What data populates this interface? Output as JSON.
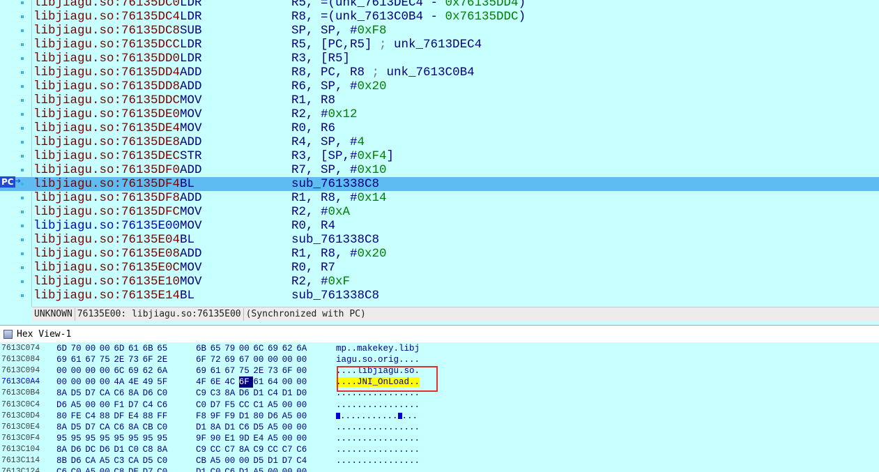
{
  "disasm": {
    "rows": [
      {
        "addr": "libjiagu.so:76135DC0",
        "mnem": "LDR",
        "ops": [
          {
            "t": "R5, =(unk_7613DEC4 - "
          },
          {
            "t": "0x76135DD4",
            "c": "num"
          },
          {
            "t": ")"
          }
        ]
      },
      {
        "addr": "libjiagu.so:76135DC4",
        "mnem": "LDR",
        "ops": [
          {
            "t": "R8, =(unk_7613C0B4 - "
          },
          {
            "t": "0x76135DDC",
            "c": "num"
          },
          {
            "t": ")"
          }
        ]
      },
      {
        "addr": "libjiagu.so:76135DC8",
        "mnem": "SUB",
        "ops": [
          {
            "t": "SP, SP, #"
          },
          {
            "t": "0xF8",
            "c": "num"
          }
        ]
      },
      {
        "addr": "libjiagu.so:76135DCC",
        "mnem": "LDR",
        "ops": [
          {
            "t": "R5, [PC,R5] "
          },
          {
            "t": ";",
            "c": "cmt"
          },
          {
            "t": " unk_7613DEC4"
          }
        ]
      },
      {
        "addr": "libjiagu.so:76135DD0",
        "mnem": "LDR",
        "ops": [
          {
            "t": "R3, [R5]"
          }
        ]
      },
      {
        "addr": "libjiagu.so:76135DD4",
        "mnem": "ADD",
        "ops": [
          {
            "t": "R8, PC, R8 "
          },
          {
            "t": ";",
            "c": "cmt"
          },
          {
            "t": " unk_7613C0B4"
          }
        ]
      },
      {
        "addr": "libjiagu.so:76135DD8",
        "mnem": "ADD",
        "ops": [
          {
            "t": "R6, SP, #"
          },
          {
            "t": "0x20",
            "c": "num"
          }
        ]
      },
      {
        "addr": "libjiagu.so:76135DDC",
        "mnem": "MOV",
        "ops": [
          {
            "t": "R1, R8"
          }
        ]
      },
      {
        "addr": "libjiagu.so:76135DE0",
        "mnem": "MOV",
        "ops": [
          {
            "t": "R2, #"
          },
          {
            "t": "0x12",
            "c": "num"
          }
        ]
      },
      {
        "addr": "libjiagu.so:76135DE4",
        "mnem": "MOV",
        "ops": [
          {
            "t": "R0, R6"
          }
        ]
      },
      {
        "addr": "libjiagu.so:76135DE8",
        "mnem": "ADD",
        "ops": [
          {
            "t": "R4, SP, #"
          },
          {
            "t": "4",
            "c": "num"
          }
        ]
      },
      {
        "addr": "libjiagu.so:76135DEC",
        "mnem": "STR",
        "ops": [
          {
            "t": "R3, [SP,#"
          },
          {
            "t": "0xF4",
            "c": "num"
          },
          {
            "t": "]"
          }
        ]
      },
      {
        "addr": "libjiagu.so:76135DF0",
        "mnem": "ADD",
        "ops": [
          {
            "t": "R7, SP, #"
          },
          {
            "t": "0x10",
            "c": "num"
          }
        ]
      },
      {
        "addr": "libjiagu.so:76135DF4",
        "mnem": "BL",
        "ops": [
          {
            "t": "sub_761338C8"
          }
        ],
        "current": true
      },
      {
        "addr": "libjiagu.so:76135DF8",
        "mnem": "ADD",
        "ops": [
          {
            "t": "R1, R8, #"
          },
          {
            "t": "0x14",
            "c": "num"
          }
        ]
      },
      {
        "addr": "libjiagu.so:76135DFC",
        "mnem": "MOV",
        "ops": [
          {
            "t": "R2, #"
          },
          {
            "t": "0xA",
            "c": "num"
          }
        ]
      },
      {
        "addr": "libjiagu.so:76135E00",
        "mnem": "MOV",
        "ops": [
          {
            "t": "R0, R4"
          }
        ],
        "blue": true
      },
      {
        "addr": "libjiagu.so:76135E04",
        "mnem": "BL",
        "ops": [
          {
            "t": "sub_761338C8"
          }
        ]
      },
      {
        "addr": "libjiagu.so:76135E08",
        "mnem": "ADD",
        "ops": [
          {
            "t": "R1, R8, #"
          },
          {
            "t": "0x20",
            "c": "num"
          }
        ]
      },
      {
        "addr": "libjiagu.so:76135E0C",
        "mnem": "MOV",
        "ops": [
          {
            "t": "R0, R7"
          }
        ]
      },
      {
        "addr": "libjiagu.so:76135E10",
        "mnem": "MOV",
        "ops": [
          {
            "t": "R2, #"
          },
          {
            "t": "0xF",
            "c": "num"
          }
        ]
      },
      {
        "addr": "libjiagu.so:76135E14",
        "mnem": "BL",
        "ops": [
          {
            "t": "sub_761338C8"
          }
        ]
      }
    ],
    "pc_label": "PC",
    "status": {
      "segment": "UNKNOWN",
      "location": "76135E00: libjiagu.so:76135E00",
      "sync": "(Synchronized with PC)"
    }
  },
  "hex_view": {
    "title": "Hex View-1",
    "rows": [
      {
        "addr": "7613C074",
        "bytes": [
          "6D",
          "70",
          "00",
          "00",
          "6D",
          "61",
          "6B",
          "65",
          "6B",
          "65",
          "79",
          "00",
          "6C",
          "69",
          "62",
          "6A"
        ],
        "ascii": [
          {
            "t": "mp..makekey.libj"
          }
        ]
      },
      {
        "addr": "7613C084",
        "bytes": [
          "69",
          "61",
          "67",
          "75",
          "2E",
          "73",
          "6F",
          "2E",
          "6F",
          "72",
          "69",
          "67",
          "00",
          "00",
          "00",
          "00"
        ],
        "ascii": [
          {
            "t": "iagu.so.orig...."
          }
        ]
      },
      {
        "addr": "7613C094",
        "bytes": [
          "00",
          "00",
          "00",
          "00",
          "6C",
          "69",
          "62",
          "6A",
          "69",
          "61",
          "67",
          "75",
          "2E",
          "73",
          "6F",
          "00"
        ],
        "ascii": [
          {
            "t": "....libjiagu.so."
          }
        ]
      },
      {
        "addr": "7613C0A4",
        "bytes": [
          "00",
          "00",
          "00",
          "00",
          "4A",
          "4E",
          "49",
          "5F",
          "4F",
          "6E",
          "4C",
          "6F",
          "61",
          "64",
          "00",
          "00"
        ],
        "ascii": [
          {
            "t": "....JNI_OnLoad..",
            "hl": true
          }
        ],
        "current": true,
        "sel": 11
      },
      {
        "addr": "7613C0B4",
        "bytes": [
          "8A",
          "D5",
          "D7",
          "CA",
          "C6",
          "8A",
          "D6",
          "C0",
          "C9",
          "C3",
          "8A",
          "D6",
          "D1",
          "C4",
          "D1",
          "D0"
        ],
        "ascii": [
          {
            "t": "................"
          }
        ]
      },
      {
        "addr": "7613C0C4",
        "bytes": [
          "D6",
          "A5",
          "00",
          "00",
          "F1",
          "D7",
          "C4",
          "C6",
          "C0",
          "D7",
          "F5",
          "CC",
          "C1",
          "A5",
          "00",
          "00"
        ],
        "ascii": [
          {
            "t": "................"
          }
        ]
      },
      {
        "addr": "7613C0D4",
        "bytes": [
          "80",
          "FE",
          "C4",
          "88",
          "DF",
          "E4",
          "88",
          "FF",
          "F8",
          "9F",
          "F9",
          "D1",
          "80",
          "D6",
          "A5",
          "00"
        ],
        "ascii": [
          {
            "blk": true
          },
          {
            "t": "..........."
          },
          {
            "blk": true
          },
          {
            "t": "..."
          }
        ]
      },
      {
        "addr": "7613C0E4",
        "bytes": [
          "8A",
          "D5",
          "D7",
          "CA",
          "C6",
          "8A",
          "CB",
          "C0",
          "D1",
          "8A",
          "D1",
          "C6",
          "D5",
          "A5",
          "00",
          "00"
        ],
        "ascii": [
          {
            "t": "................"
          }
        ]
      },
      {
        "addr": "7613C0F4",
        "bytes": [
          "95",
          "95",
          "95",
          "95",
          "95",
          "95",
          "95",
          "95",
          "9F",
          "90",
          "E1",
          "9D",
          "E4",
          "A5",
          "00",
          "00"
        ],
        "ascii": [
          {
            "t": "................"
          }
        ]
      },
      {
        "addr": "7613C104",
        "bytes": [
          "8A",
          "D6",
          "DC",
          "D6",
          "D1",
          "C0",
          "C8",
          "8A",
          "C9",
          "CC",
          "C7",
          "8A",
          "C9",
          "CC",
          "C7",
          "C6"
        ],
        "ascii": [
          {
            "t": "................"
          }
        ]
      },
      {
        "addr": "7613C114",
        "bytes": [
          "8B",
          "D6",
          "CA",
          "A5",
          "C3",
          "CA",
          "D5",
          "C0",
          "CB",
          "A5",
          "00",
          "00",
          "D5",
          "D1",
          "D7",
          "C4"
        ],
        "ascii": [
          {
            "t": "................"
          }
        ]
      },
      {
        "addr": "7613C124",
        "bytes": [
          "C6",
          "C0",
          "A5",
          "00",
          "C8",
          "DE",
          "D7",
          "C0",
          "D1",
          "C0",
          "C6",
          "D1",
          "A5",
          "00",
          "00",
          "00"
        ],
        "ascii": [
          {
            "t": "................"
          }
        ]
      }
    ]
  }
}
